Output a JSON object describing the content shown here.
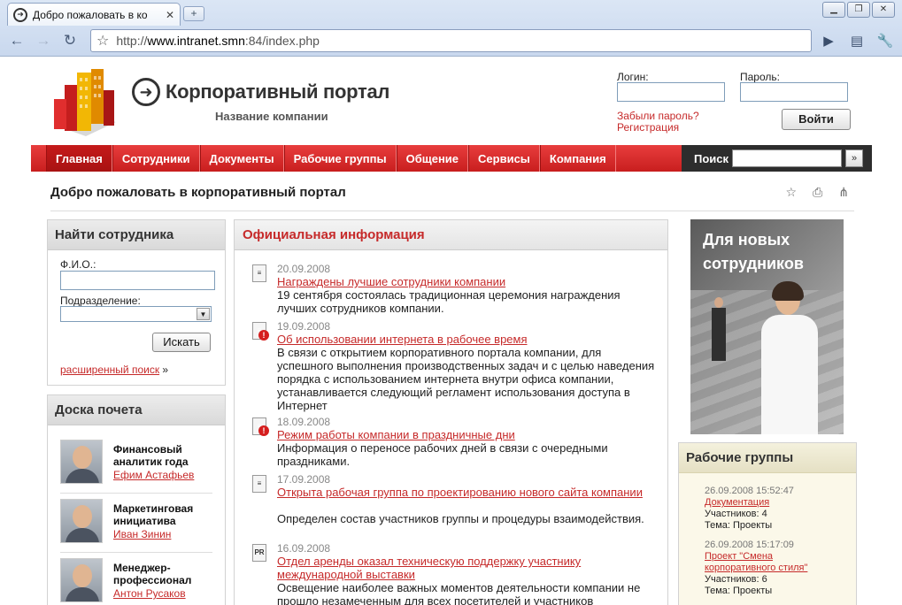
{
  "browser": {
    "tab_title": "Добро пожаловать в ко",
    "url_prefix": "http://",
    "url_host": "www.intranet.smn",
    "url_rest": ":84/index.php"
  },
  "header": {
    "portal_title": "Корпоративный портал",
    "company_name": "Название компании",
    "login_label": "Логин:",
    "password_label": "Пароль:",
    "forgot_link": "Забыли пароль?",
    "register_link": "Регистрация",
    "login_button": "Войти"
  },
  "nav": {
    "items": [
      "Главная",
      "Сотрудники",
      "Документы",
      "Рабочие группы",
      "Общение",
      "Сервисы",
      "Компания"
    ],
    "search_label": "Поиск",
    "search_go": "»"
  },
  "page_title": "Добро пожаловать в корпоративный портал",
  "find_employee": {
    "title": "Найти сотрудника",
    "fio_label": "Ф.И.О.:",
    "dept_label": "Подразделение:",
    "search_button": "Искать",
    "advanced_link": "расширенный поиск",
    "advanced_suffix": "»"
  },
  "honor_board": {
    "title": "Доска почета",
    "items": [
      {
        "title": "Финансовый аналитик года",
        "name": "Ефим Астафьев"
      },
      {
        "title": "Маркетинговая инициатива",
        "name": "Иван Зинин"
      },
      {
        "title": "Менеджер-профессионал",
        "name": "Антон Русаков"
      }
    ]
  },
  "news": {
    "title": "Официальная информация",
    "items": [
      {
        "icon": "doc",
        "date": "20.09.2008",
        "link": "Награждены лучшие сотрудники компании",
        "text": "19 сентября состоялась традиционная церемония награждения лучших сотрудников компании."
      },
      {
        "icon": "warn",
        "date": "19.09.2008",
        "link": "Об использовании интернета в рабочее время",
        "text": "В связи с открытием корпоративного портала компании, для успешного выполнения производственных задач и с целью наведения порядка с использованием интернета внутри офиса компании, устанавливается следующий регламент использования доступа в Интернет"
      },
      {
        "icon": "warn",
        "date": "18.09.2008",
        "link": "Режим работы компании в праздничные дни",
        "text": "Информация о переносе рабочих дней в связи с очередными праздниками."
      },
      {
        "icon": "doc",
        "date": "17.09.2008",
        "link": "Открыта рабочая группа по проектированию нового сайта компании",
        "text": "Определен состав участников группы и процедуры взаимодействия."
      },
      {
        "icon": "pr",
        "date": "16.09.2008",
        "link": "Отдел аренды оказал техническую поддержку участнику международной выставки",
        "text": "Освещение наиболее важных моментов деятельности компании не прошло незамеченным для всех посетителей и участников"
      }
    ]
  },
  "promo": {
    "line1": "Для новых",
    "line2": "сотрудников"
  },
  "groups": {
    "title": "Рабочие группы",
    "items": [
      {
        "date": "26.09.2008 15:52:47",
        "link": "Документация",
        "members": "Участников: 4",
        "topic": "Тема: Проекты"
      },
      {
        "date": "26.09.2008 15:17:09",
        "link": "Проект \"Смена корпоративного стиля\"",
        "members": "Участников: 6",
        "topic": "Тема: Проекты"
      }
    ]
  }
}
